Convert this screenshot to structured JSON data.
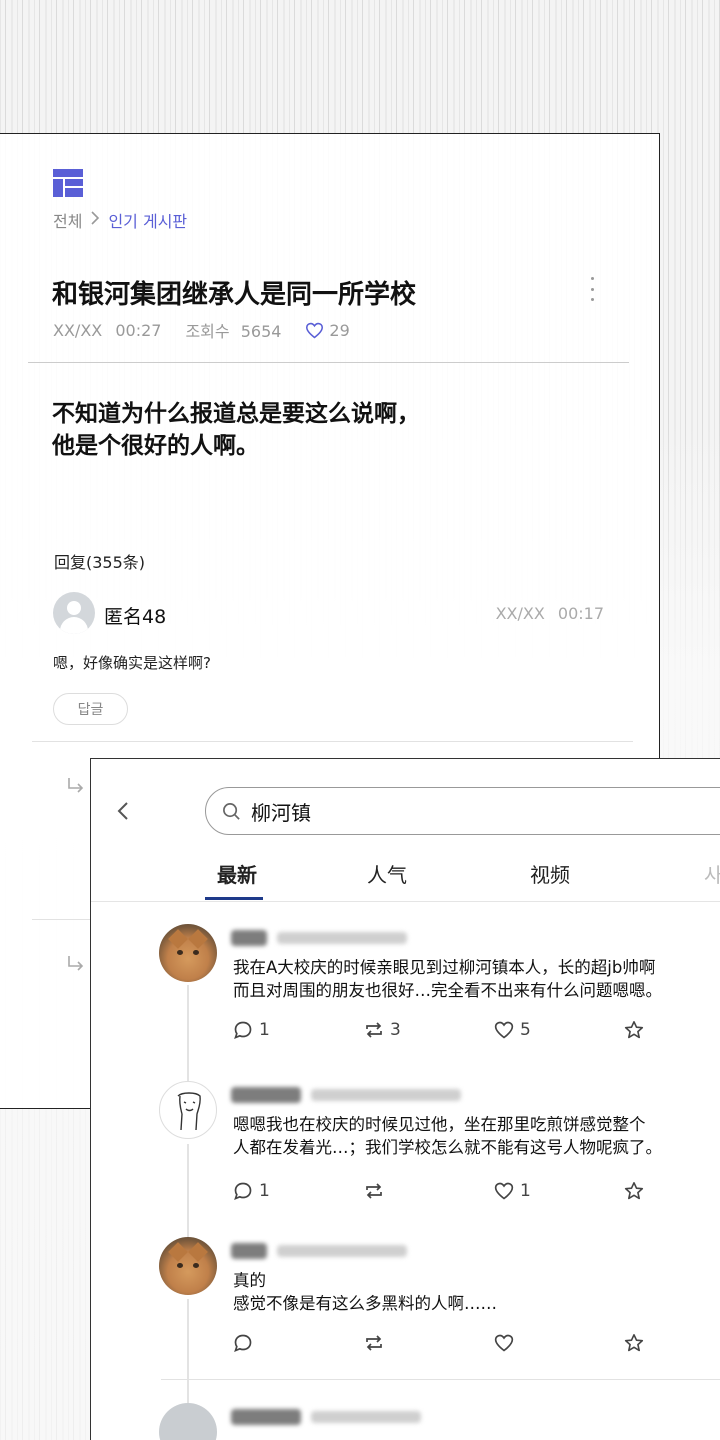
{
  "community_post": {
    "breadcrumb": {
      "root": "전체",
      "separator": ">",
      "current": "인기 게시판"
    },
    "title": "和银河集团继承人是同一所学校",
    "date": "XX/XX",
    "time": "00:27",
    "views_label": "조회수",
    "views_count": "5654",
    "likes": "29",
    "body": "不知道为什么报道总是要这么说啊，\n他是个很好的人啊。",
    "reply_count": "回复(355条)",
    "comment": {
      "author": "匿名48",
      "date": "XX/XX",
      "time": "00:17",
      "text": "嗯，好像确实是这样啊?",
      "reply_label": "답글"
    }
  },
  "search_panel": {
    "query": "柳河镇",
    "tabs": [
      {
        "label": "最新",
        "active": true
      },
      {
        "label": "人气",
        "active": false
      },
      {
        "label": "视频",
        "active": false
      },
      {
        "label": "사",
        "active": false
      }
    ],
    "posts": [
      {
        "text": "我在A大校庆的时候亲眼见到过柳河镇本人，长的超jb帅啊\n而且对周围的朋友也很好…完全看不出来有什么问题嗯嗯。",
        "comments": "1",
        "reposts": "3",
        "likes": "5"
      },
      {
        "text": "嗯嗯我也在校庆的时候见过他，坐在那里吃煎饼感觉整个\n人都在发着光…；我们学校怎么就不能有这号人物呢疯了。",
        "comments": "1",
        "reposts": "",
        "likes": "1"
      },
      {
        "text": "真的\n感觉不像是有这么多黑料的人啊……",
        "comments": "",
        "reposts": "",
        "likes": ""
      }
    ]
  },
  "colors": {
    "accent": "#5a5fd6",
    "tab_underline": "#1e3a8a",
    "meta_gray": "#999999"
  }
}
